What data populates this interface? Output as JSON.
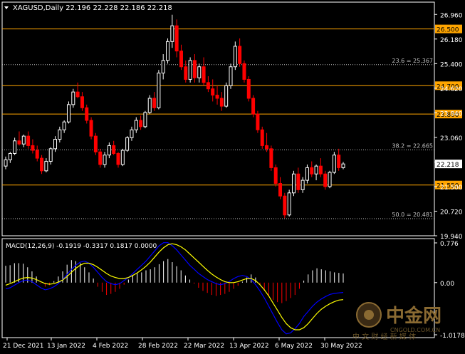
{
  "header": {
    "symbol_line": "XAGUSD,Daily  22.196 22.228 22.186 22.218"
  },
  "colors": {
    "background": "#000000",
    "frame": "#ffffff",
    "bull_candle": "#ffffff",
    "bear_candle": "#ff0000",
    "level_line": "#ffa500",
    "fib_line": "#c0c0c0",
    "current_price_box": "#ffffff",
    "level_box": "#ffa500",
    "macd_histogram_positive": "#ffffff",
    "macd_histogram_negative": "#ff0000",
    "macd_signal": "#ffff00",
    "macd_main": "#0000ff"
  },
  "watermark": {
    "brand": "中金网",
    "domain": "CNGOLD.COM.CN",
    "tagline": "中 文 财 经 新 媒 体"
  },
  "chart_data": [
    {
      "type": "candlestick",
      "title": "XAGUSD,Daily",
      "ohlc_header": {
        "open": 22.196,
        "high": 22.228,
        "low": 22.186,
        "close": 22.218
      },
      "y_ticks": [
        "26.960",
        "26.180",
        "25.400",
        "24.620",
        "23.840",
        "23.060",
        "22.280",
        "21.500",
        "20.720",
        "19.940"
      ],
      "ylim": [
        19.94,
        27.35
      ],
      "x_ticks": [
        "21 Dec 2021",
        "13 Jan 2022",
        "4 Feb 2022",
        "28 Feb 2022",
        "22 Mar 2022",
        "13 Apr 2022",
        "6 May 2022",
        "30 May 2022"
      ],
      "horizontal_levels": [
        {
          "value": 26.5,
          "label": "26.500"
        },
        {
          "value": 24.7,
          "label": "24.700"
        },
        {
          "value": 23.8,
          "label": "23.800"
        },
        {
          "value": 21.55,
          "label": "21.550"
        }
      ],
      "fib_levels": [
        {
          "value": 25.367,
          "label": "23.6 = 25.367"
        },
        {
          "value": 22.665,
          "label": "38.2 = 22.665"
        },
        {
          "value": 20.481,
          "label": "50.0 = 20.481"
        }
      ],
      "current_price": {
        "value": 22.218,
        "label": "22.218"
      },
      "candles": [
        [
          22.15,
          22.45,
          22.05,
          22.35
        ],
        [
          22.35,
          22.6,
          22.25,
          22.55
        ],
        [
          22.55,
          23.05,
          22.5,
          22.95
        ],
        [
          22.95,
          23.25,
          22.8,
          22.85
        ],
        [
          22.85,
          23.15,
          22.75,
          23.1
        ],
        [
          23.1,
          23.25,
          22.7,
          22.8
        ],
        [
          22.8,
          23.0,
          22.55,
          22.65
        ],
        [
          22.65,
          22.8,
          22.3,
          22.4
        ],
        [
          22.4,
          22.5,
          21.9,
          22.0
        ],
        [
          22.0,
          22.4,
          21.95,
          22.3
        ],
        [
          22.3,
          22.75,
          22.2,
          22.7
        ],
        [
          22.7,
          23.1,
          22.6,
          23.0
        ],
        [
          23.0,
          23.4,
          22.9,
          23.3
        ],
        [
          23.3,
          23.6,
          23.2,
          23.55
        ],
        [
          23.55,
          24.2,
          23.5,
          24.1
        ],
        [
          24.1,
          24.6,
          24.0,
          24.5
        ],
        [
          24.5,
          24.8,
          24.3,
          24.35
        ],
        [
          24.35,
          24.5,
          23.9,
          24.0
        ],
        [
          24.0,
          24.1,
          23.5,
          23.6
        ],
        [
          23.6,
          23.7,
          23.0,
          23.1
        ],
        [
          23.1,
          23.2,
          22.5,
          22.6
        ],
        [
          22.6,
          22.7,
          22.1,
          22.2
        ],
        [
          22.2,
          22.6,
          22.1,
          22.5
        ],
        [
          22.5,
          22.9,
          22.4,
          22.8
        ],
        [
          22.8,
          22.95,
          22.5,
          22.55
        ],
        [
          22.55,
          22.6,
          22.1,
          22.2
        ],
        [
          22.2,
          22.7,
          22.15,
          22.65
        ],
        [
          22.65,
          23.1,
          22.6,
          23.05
        ],
        [
          23.05,
          23.4,
          22.95,
          23.3
        ],
        [
          23.3,
          23.7,
          23.2,
          23.6
        ],
        [
          23.6,
          23.75,
          23.3,
          23.4
        ],
        [
          23.4,
          23.9,
          23.35,
          23.85
        ],
        [
          23.85,
          24.4,
          23.8,
          24.3
        ],
        [
          24.3,
          24.5,
          23.9,
          24.0
        ],
        [
          24.0,
          25.2,
          23.95,
          25.1
        ],
        [
          25.1,
          25.7,
          24.9,
          25.5
        ],
        [
          25.5,
          26.2,
          25.4,
          26.1
        ],
        [
          26.1,
          26.95,
          25.9,
          26.6
        ],
        [
          26.6,
          26.8,
          25.6,
          25.8
        ],
        [
          25.8,
          26.0,
          25.2,
          25.3
        ],
        [
          25.3,
          25.5,
          24.8,
          24.9
        ],
        [
          24.9,
          25.6,
          24.8,
          25.5
        ],
        [
          25.5,
          25.7,
          24.8,
          24.95
        ],
        [
          24.95,
          25.4,
          24.8,
          25.3
        ],
        [
          25.3,
          25.6,
          24.7,
          24.8
        ],
        [
          24.8,
          25.0,
          24.5,
          24.6
        ],
        [
          24.6,
          24.9,
          24.2,
          24.4
        ],
        [
          24.4,
          24.7,
          24.1,
          24.3
        ],
        [
          24.3,
          24.5,
          23.9,
          24.05
        ],
        [
          24.05,
          24.8,
          24.0,
          24.7
        ],
        [
          24.7,
          25.4,
          24.6,
          25.3
        ],
        [
          25.3,
          26.1,
          25.2,
          25.95
        ],
        [
          25.95,
          26.2,
          25.3,
          25.4
        ],
        [
          25.4,
          25.5,
          24.8,
          24.9
        ],
        [
          24.9,
          25.0,
          24.2,
          24.3
        ],
        [
          24.3,
          24.4,
          23.7,
          23.8
        ],
        [
          23.8,
          23.9,
          23.2,
          23.3
        ],
        [
          23.3,
          23.4,
          22.7,
          22.8
        ],
        [
          22.8,
          23.2,
          22.6,
          22.7
        ],
        [
          22.7,
          22.8,
          22.0,
          22.1
        ],
        [
          22.1,
          22.2,
          21.5,
          21.6
        ],
        [
          21.6,
          21.8,
          21.1,
          21.2
        ],
        [
          21.2,
          21.3,
          20.5,
          20.6
        ],
        [
          20.6,
          21.4,
          20.55,
          21.3
        ],
        [
          21.3,
          22.0,
          21.2,
          21.9
        ],
        [
          21.9,
          22.1,
          21.3,
          21.4
        ],
        [
          21.4,
          21.8,
          21.3,
          21.7
        ],
        [
          21.7,
          22.2,
          21.6,
          22.1
        ],
        [
          22.1,
          22.3,
          21.8,
          21.9
        ],
        [
          21.9,
          22.2,
          21.7,
          22.15
        ],
        [
          22.15,
          22.4,
          21.8,
          21.9
        ],
        [
          21.9,
          22.0,
          21.4,
          21.5
        ],
        [
          21.5,
          22.0,
          21.45,
          21.95
        ],
        [
          21.95,
          22.6,
          21.9,
          22.5
        ],
        [
          22.5,
          22.7,
          22.0,
          22.1
        ],
        [
          22.1,
          22.28,
          22.05,
          22.218
        ]
      ]
    },
    {
      "type": "macd",
      "title": "MACD(12,26,9) -0.1919 -0.3317 0.1817 0.0000",
      "params": [
        12,
        26,
        9
      ],
      "values": {
        "main": -0.1919,
        "signal": -0.3317,
        "histogram": 0.1817,
        "extra": 0.0
      },
      "y_ticks": [
        "0.776",
        "0.00",
        "-1.0178"
      ],
      "ylim": [
        -1.0178,
        0.776
      ],
      "histogram": [
        0.33,
        0.34,
        0.38,
        0.38,
        0.37,
        0.3,
        0.22,
        0.12,
        -0.02,
        -0.08,
        -0.05,
        0.03,
        0.12,
        0.22,
        0.35,
        0.44,
        0.42,
        0.38,
        0.3,
        0.2,
        0.08,
        -0.08,
        -0.18,
        -0.24,
        -0.22,
        -0.18,
        -0.12,
        -0.04,
        0.06,
        0.14,
        0.18,
        0.2,
        0.24,
        0.26,
        0.3,
        0.36,
        0.42,
        0.46,
        0.4,
        0.32,
        0.24,
        0.14,
        0.06,
        -0.02,
        -0.1,
        -0.16,
        -0.2,
        -0.24,
        -0.26,
        -0.24,
        -0.22,
        -0.18,
        -0.12,
        -0.06,
        0.02,
        0.1,
        0.16,
        0.1,
        -0.04,
        -0.16,
        -0.26,
        -0.34,
        -0.38,
        -0.4,
        -0.36,
        -0.3,
        -0.24,
        -0.12,
        0.04,
        0.16,
        0.24,
        0.28,
        0.26,
        0.24,
        0.22,
        0.2,
        0.19,
        0.18
      ],
      "signal": [
        -0.05,
        -0.02,
        0.02,
        0.06,
        0.09,
        0.1,
        0.09,
        0.06,
        0.02,
        -0.02,
        -0.03,
        -0.02,
        0.01,
        0.05,
        0.12,
        0.2,
        0.28,
        0.34,
        0.38,
        0.38,
        0.35,
        0.3,
        0.24,
        0.18,
        0.13,
        0.1,
        0.08,
        0.08,
        0.1,
        0.14,
        0.19,
        0.25,
        0.32,
        0.4,
        0.5,
        0.6,
        0.68,
        0.74,
        0.76,
        0.74,
        0.7,
        0.64,
        0.56,
        0.48,
        0.4,
        0.32,
        0.24,
        0.17,
        0.11,
        0.06,
        0.02,
        0.0,
        0.0,
        0.02,
        0.05,
        0.08,
        0.08,
        0.04,
        -0.04,
        -0.14,
        -0.26,
        -0.4,
        -0.54,
        -0.68,
        -0.8,
        -0.88,
        -0.92,
        -0.92,
        -0.88,
        -0.8,
        -0.7,
        -0.6,
        -0.52,
        -0.46,
        -0.41,
        -0.37,
        -0.34,
        -0.3317
      ],
      "main": [
        -0.12,
        -0.1,
        -0.05,
        0.0,
        0.04,
        0.05,
        0.02,
        -0.04,
        -0.1,
        -0.14,
        -0.12,
        -0.08,
        -0.02,
        0.06,
        0.16,
        0.26,
        0.34,
        0.4,
        0.42,
        0.38,
        0.3,
        0.2,
        0.1,
        0.02,
        -0.02,
        -0.04,
        -0.02,
        0.04,
        0.1,
        0.18,
        0.26,
        0.34,
        0.42,
        0.52,
        0.62,
        0.72,
        0.78,
        0.78,
        0.72,
        0.64,
        0.54,
        0.44,
        0.34,
        0.26,
        0.18,
        0.12,
        0.06,
        0.02,
        -0.02,
        -0.04,
        -0.02,
        0.02,
        0.08,
        0.12,
        0.14,
        0.12,
        0.06,
        -0.04,
        -0.16,
        -0.3,
        -0.46,
        -0.62,
        -0.78,
        -0.92,
        -1.0,
        -0.98,
        -0.9,
        -0.8,
        -0.66,
        -0.56,
        -0.46,
        -0.38,
        -0.32,
        -0.27,
        -0.23,
        -0.21,
        -0.2,
        -0.1919
      ]
    }
  ]
}
